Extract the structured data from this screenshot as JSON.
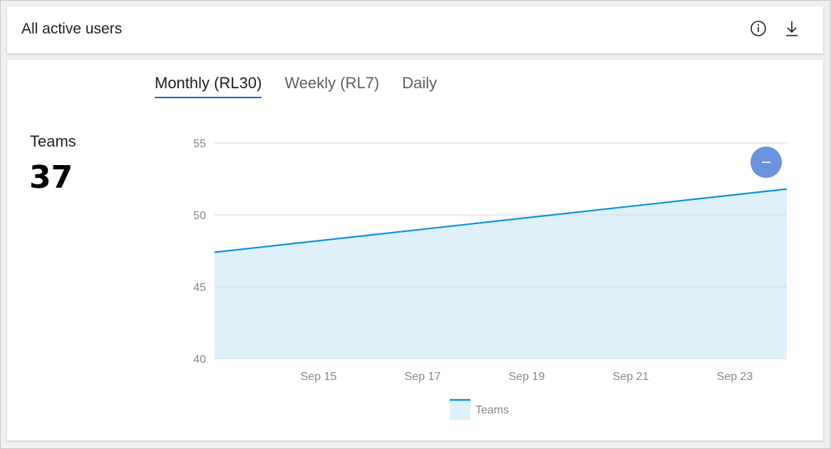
{
  "header": {
    "title": "All active users"
  },
  "tabs": [
    {
      "label": "Monthly (RL30)",
      "active": true
    },
    {
      "label": "Weekly (RL7)",
      "active": false
    },
    {
      "label": "Daily",
      "active": false
    }
  ],
  "metric": {
    "label": "Teams",
    "value": "37"
  },
  "icons": {
    "info": "info-icon",
    "download": "download-icon",
    "collapse": "minus-circle-icon"
  },
  "colors": {
    "line": "#0c91dd",
    "area": "#def0f9",
    "accent": "#106ebe",
    "collapse_button": "#6b93e0"
  },
  "chart_data": {
    "type": "area",
    "ylim": [
      40,
      55
    ],
    "yticks": [
      40,
      45,
      50,
      55
    ],
    "xlim": [
      "Sep 13",
      "Sep 24"
    ],
    "xticks": [
      "Sep 15",
      "Sep 17",
      "Sep 19",
      "Sep 21",
      "Sep 23"
    ],
    "series": [
      {
        "name": "Teams",
        "x": [
          "Sep 13",
          "Sep 24"
        ],
        "values": [
          47.4,
          51.8
        ]
      }
    ],
    "legend": [
      "Teams"
    ],
    "legend_position": "bottom",
    "grid": true
  }
}
